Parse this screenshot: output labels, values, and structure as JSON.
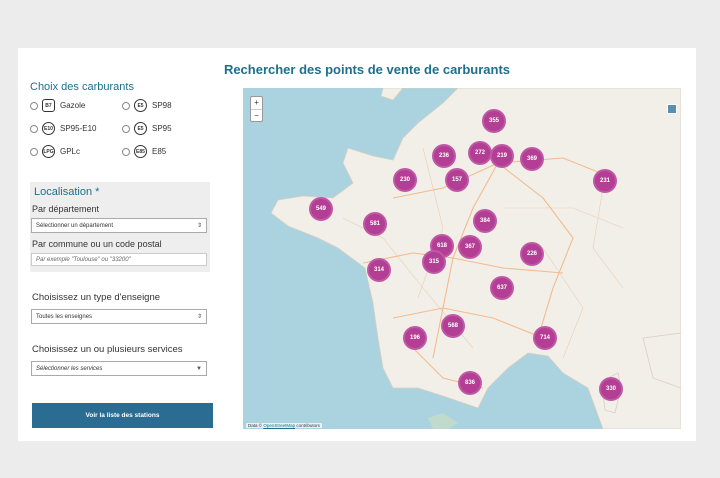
{
  "page_title": "Rechercher des points de vente de carburants",
  "fuel_section": {
    "title": "Choix des carburants",
    "fuels": [
      {
        "badge": "B7",
        "label": "Gazole"
      },
      {
        "badge": "E5",
        "label": "SP98"
      },
      {
        "badge": "E10",
        "label": "SP95-E10"
      },
      {
        "badge": "E5",
        "label": "SP95"
      },
      {
        "badge": "LPG",
        "label": "GPLc"
      },
      {
        "badge": "E85",
        "label": "E85"
      }
    ]
  },
  "localisation": {
    "title": "Localisation *",
    "departement_label": "Par département",
    "departement_select": "Sélectionner un département",
    "commune_label": "Par commune ou un code postal",
    "commune_placeholder": "Par exemple \"Toulouse\" ou \"33200\""
  },
  "enseigne": {
    "label": "Choisissez un type d'enseigne",
    "select_value": "Toutes les enseignes"
  },
  "services": {
    "label": "Choisissez un ou plusieurs services",
    "select_value": "Sélectionner les services"
  },
  "submit_label": "Voir la liste des stations",
  "map": {
    "zoom_in": "+",
    "zoom_out": "−",
    "attribution_prefix": "Data ©",
    "attribution_link": "OpenStreetMap",
    "attribution_suffix": "contributors",
    "clusters": [
      "355",
      "236",
      "272",
      "219",
      "369",
      "230",
      "157",
      "231",
      "549",
      "581",
      "384",
      "618",
      "367",
      "315",
      "226",
      "314",
      "637",
      "196",
      "568",
      "714",
      "836",
      "330"
    ]
  },
  "colors": {
    "accent": "#1f6f8b",
    "button": "#2b6c92",
    "cluster": "#b33e93",
    "sea": "#aad3df",
    "land": "#f2efe9"
  }
}
